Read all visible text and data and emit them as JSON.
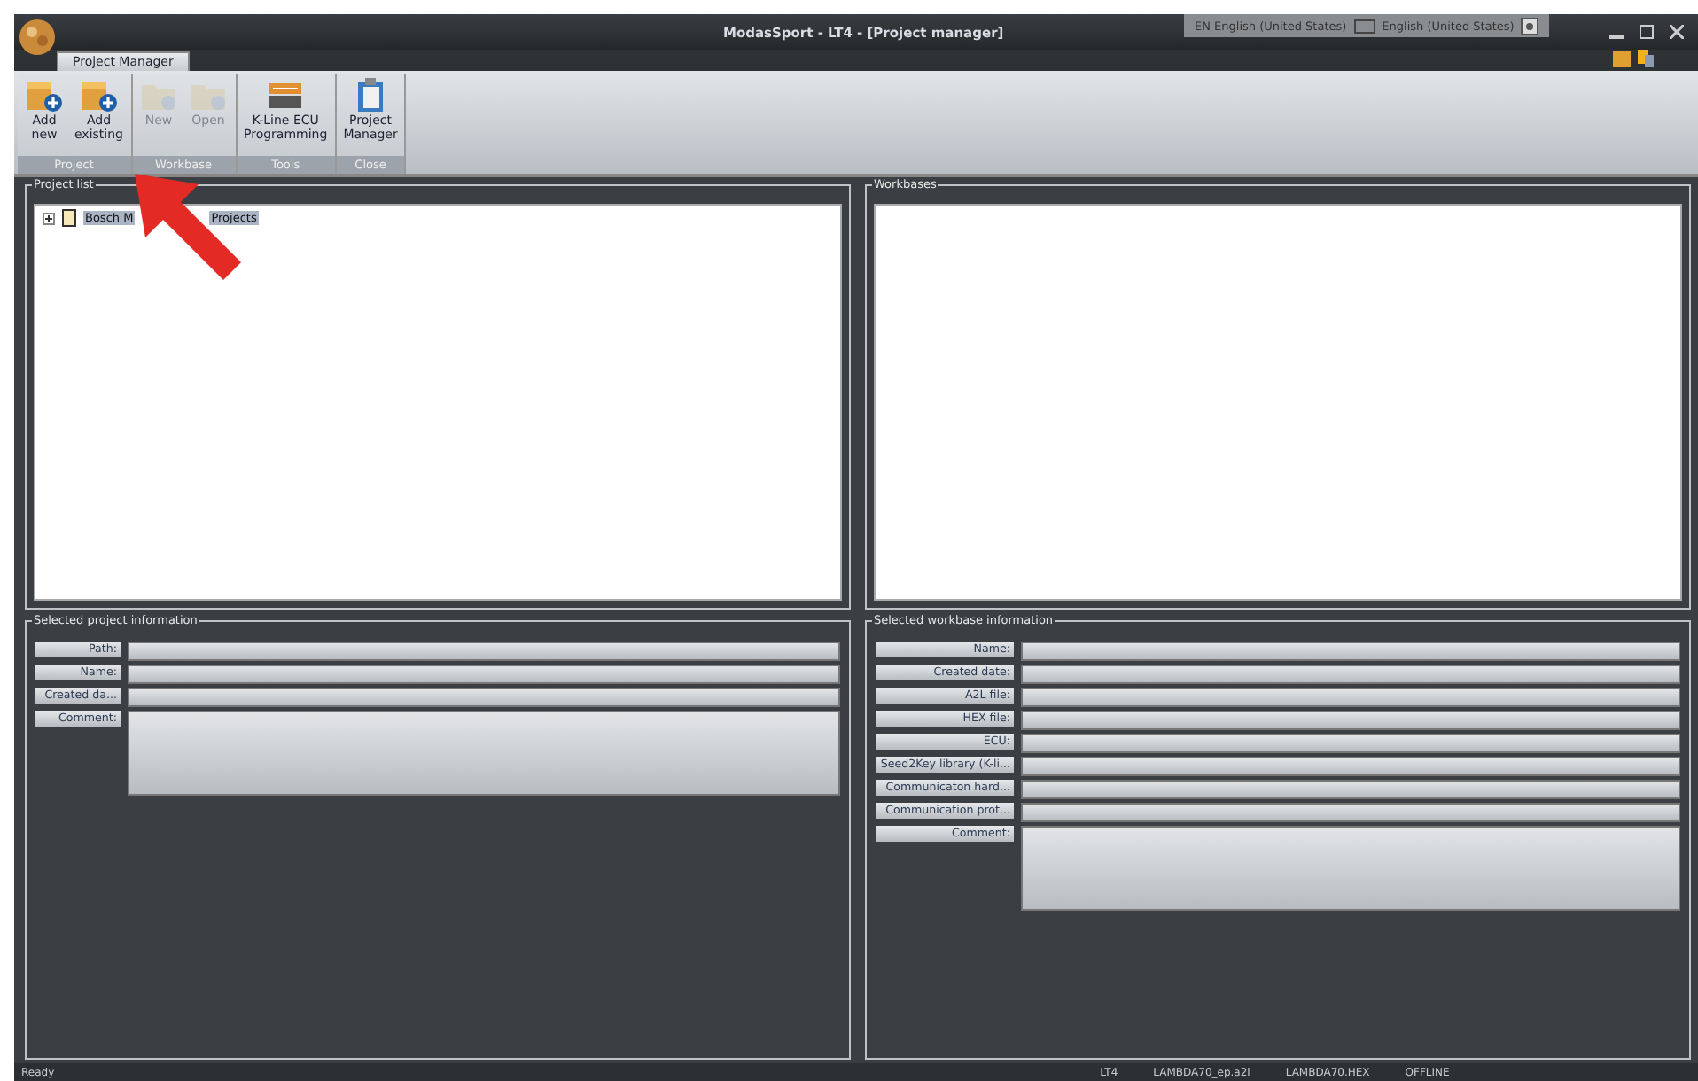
{
  "window": {
    "title": "ModasSport - LT4 - [Project manager]"
  },
  "language_bar": {
    "input_language": "EN English (United States)",
    "keyboard": "English (United States)"
  },
  "tabs": [
    {
      "label": "Project Manager",
      "selected": true
    }
  ],
  "ribbon": {
    "groups": [
      {
        "label": "Project",
        "buttons": [
          {
            "label": "Add\nnew",
            "kind": "add-new",
            "disabled": false
          },
          {
            "label": "Add\nexisting",
            "kind": "add-existing",
            "disabled": false
          }
        ]
      },
      {
        "label": "Workbase",
        "buttons": [
          {
            "label": "New",
            "kind": "folder-new",
            "disabled": true
          },
          {
            "label": "Open",
            "kind": "folder-open",
            "disabled": true
          }
        ]
      },
      {
        "label": "Tools",
        "buttons": [
          {
            "label": "K-Line ECU\nProgramming",
            "kind": "ecu",
            "disabled": false
          }
        ]
      },
      {
        "label": "Close",
        "buttons": [
          {
            "label": "Project\nManager",
            "kind": "clipboard",
            "disabled": false
          }
        ]
      }
    ]
  },
  "project_list": {
    "title": "Project list",
    "items": [
      {
        "label_start": "Bosch M",
        "label_end": "Projects",
        "expanded": false,
        "selected": true
      }
    ]
  },
  "workbases": {
    "title": "Workbases"
  },
  "project_info": {
    "title": "Selected project information",
    "fields": [
      {
        "label": "Path:",
        "kind": "line"
      },
      {
        "label": "Name:",
        "kind": "line"
      },
      {
        "label": "Created da...",
        "kind": "line"
      },
      {
        "label": "Comment:",
        "kind": "multiline"
      }
    ]
  },
  "workbase_info": {
    "title": "Selected workbase information",
    "fields": [
      {
        "label": "Name:",
        "kind": "line"
      },
      {
        "label": "Created date:",
        "kind": "line"
      },
      {
        "label": "A2L file:",
        "kind": "line"
      },
      {
        "label": "HEX file:",
        "kind": "line"
      },
      {
        "label": "ECU:",
        "kind": "line"
      },
      {
        "label": "Seed2Key library (K-li...",
        "kind": "line"
      },
      {
        "label": "Communicaton hard...",
        "kind": "line"
      },
      {
        "label": "Communication prot...",
        "kind": "line"
      },
      {
        "label": "Comment:",
        "kind": "multiline"
      }
    ]
  },
  "status_bar": [
    "Ready",
    "LT4",
    "LAMBDA70_ep.a2l",
    "LAMBDA70.HEX",
    "OFFLINE"
  ]
}
